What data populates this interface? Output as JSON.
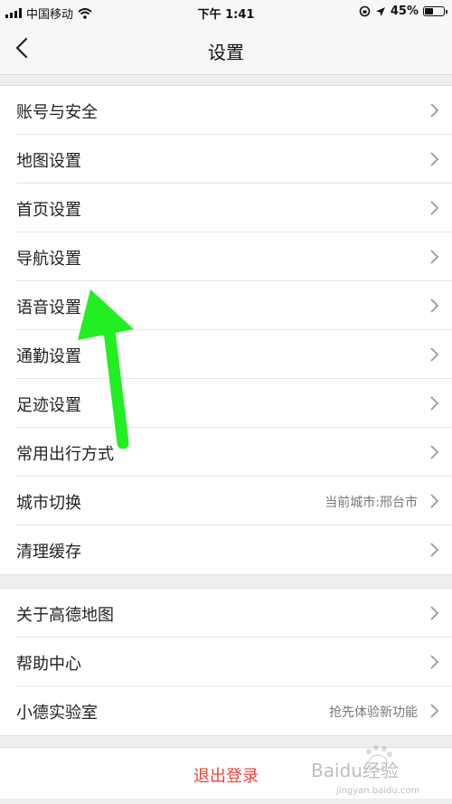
{
  "status_bar": {
    "carrier": "中国移动",
    "time": "下午 1:41",
    "battery": "45%",
    "battery_level": 0.45
  },
  "nav": {
    "title": "设置"
  },
  "groups": [
    {
      "items": [
        {
          "label": "账号与安全"
        },
        {
          "label": "地图设置"
        },
        {
          "label": "首页设置"
        },
        {
          "label": "导航设置"
        },
        {
          "label": "语音设置"
        },
        {
          "label": "通勤设置"
        },
        {
          "label": "足迹设置"
        },
        {
          "label": "常用出行方式"
        },
        {
          "label": "城市切换",
          "value": "当前城市:邢台市"
        },
        {
          "label": "清理缓存"
        }
      ]
    },
    {
      "items": [
        {
          "label": "关于高德地图"
        },
        {
          "label": "帮助中心"
        },
        {
          "label": "小德实验室",
          "value": "抢先体验新功能"
        }
      ]
    }
  ],
  "logout": {
    "label": "退出登录"
  },
  "watermark": {
    "text": "Baidu经验",
    "url": "jingyan.baidu.com"
  },
  "colors": {
    "logout_text": "#e8443a",
    "arrow": "#22ee22",
    "background": "#eeeeee"
  }
}
